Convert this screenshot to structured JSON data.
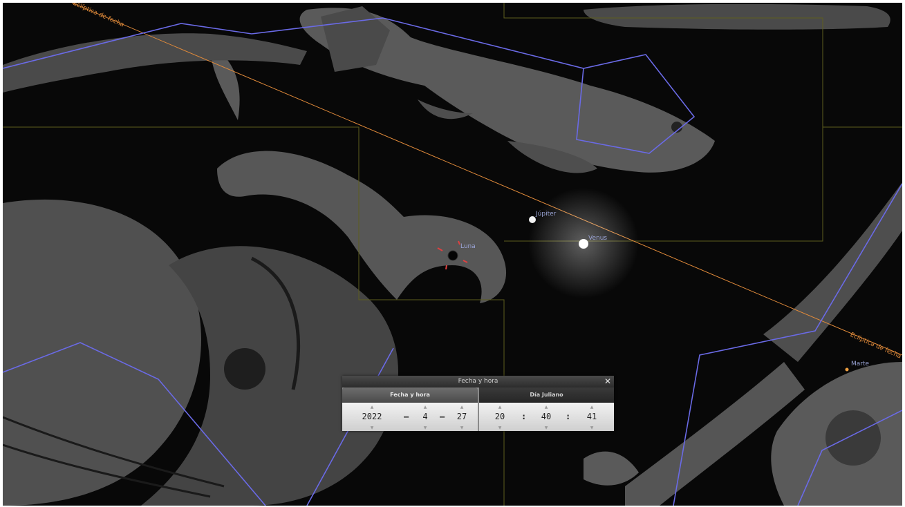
{
  "sky": {
    "ecliptic_label": "Eclíptica de fecha",
    "objects": [
      {
        "name": "Júpiter"
      },
      {
        "name": "Venus"
      },
      {
        "name": "Luna"
      },
      {
        "name": "Marte"
      }
    ]
  },
  "dialog": {
    "title": "Fecha y hora",
    "close_icon": "close-icon",
    "tabs": [
      {
        "label": "Fecha y hora",
        "active": true
      },
      {
        "label": "Día Juliano",
        "active": false
      }
    ],
    "date": {
      "year": "2022",
      "month": "4",
      "day": "27",
      "separator": "–"
    },
    "time": {
      "hour": "20",
      "minute": "40",
      "second": "41",
      "separator": ":"
    }
  },
  "colors": {
    "constellation_lines": "#6a6ae6",
    "constellation_boundaries": "#5e5e1e",
    "ecliptic": "#e08a3a",
    "selection_marker": "#e04040"
  }
}
